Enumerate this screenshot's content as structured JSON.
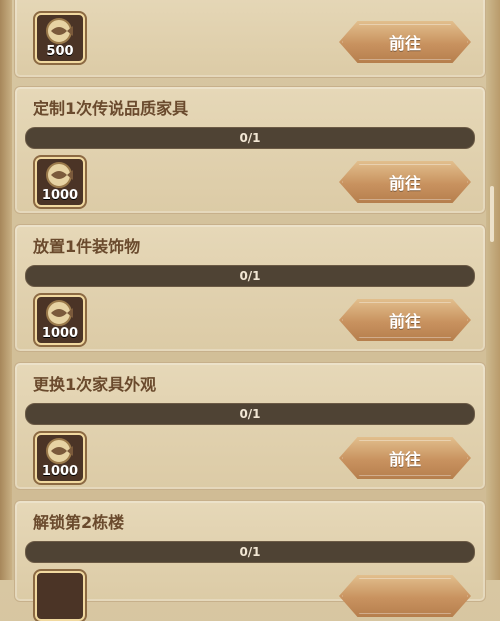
{
  "tasks": [
    {
      "title": "",
      "progress": "",
      "reward_count": "500",
      "button": "前往"
    },
    {
      "title": "定制1次传说品质家具",
      "progress": "0/1",
      "reward_count": "1000",
      "button": "前往"
    },
    {
      "title": "放置1件装饰物",
      "progress": "0/1",
      "reward_count": "1000",
      "button": "前往"
    },
    {
      "title": "更换1次家具外观",
      "progress": "0/1",
      "reward_count": "1000",
      "button": "前往"
    },
    {
      "title": "解锁第2栋楼",
      "progress": "0/1",
      "reward_count": "",
      "button": ""
    }
  ],
  "icons": {
    "reward": "fish-coin-icon"
  }
}
